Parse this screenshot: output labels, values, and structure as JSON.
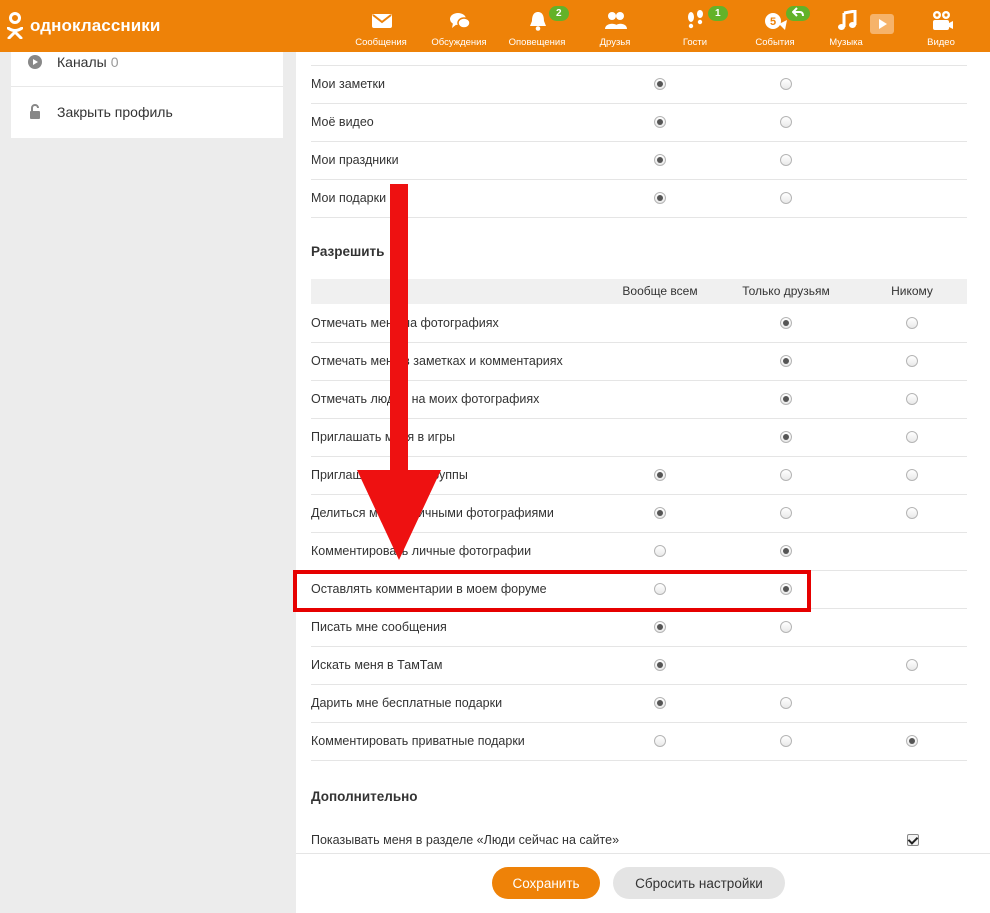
{
  "header": {
    "logo_text": "одноклассники",
    "brand_color": "#ee8208",
    "nav": [
      {
        "label": "Сообщения",
        "icon": "envelope-icon"
      },
      {
        "label": "Обсуждения",
        "icon": "chat-bubbles-icon"
      },
      {
        "label": "Оповещения",
        "icon": "bell-icon",
        "badge": "2"
      },
      {
        "label": "Друзья",
        "icon": "friends-icon"
      },
      {
        "label": "Гости",
        "icon": "footprints-icon",
        "badge": "1"
      },
      {
        "label": "События",
        "icon": "events-icon",
        "badge_icon": "reply-arrow-icon"
      },
      {
        "label": "Музыка",
        "icon": "music-note-icon"
      },
      {
        "label": "",
        "icon": "video-play-icon"
      },
      {
        "label": "Видео",
        "icon": "video-camera-icon"
      }
    ]
  },
  "sidebar": {
    "items": [
      {
        "label": "Каналы",
        "count": "0",
        "icon": "channels-icon"
      },
      {
        "label": "Закрыть профиль",
        "icon": "lock-icon"
      }
    ]
  },
  "visibility_rows": [
    {
      "label": "Мои заметки",
      "col1": true,
      "col2": false
    },
    {
      "label": "Моё видео",
      "col1": true,
      "col2": false
    },
    {
      "label": "Мои праздники",
      "col1": true,
      "col2": false
    },
    {
      "label": "Мои подарки",
      "col1": true,
      "col2": false
    }
  ],
  "allow_section": {
    "title": "Разрешить",
    "columns": [
      "Вообще всем",
      "Только друзьям",
      "Никому"
    ],
    "rows": [
      {
        "label": "Отмечать меня на фотографиях",
        "options": [
          null,
          true,
          false
        ]
      },
      {
        "label": "Отмечать меня в заметках и комментариях",
        "options": [
          null,
          true,
          false
        ]
      },
      {
        "label": "Отмечать людей на моих фотографиях",
        "options": [
          null,
          true,
          false
        ]
      },
      {
        "label": "Приглашать меня в игры",
        "options": [
          null,
          true,
          false
        ]
      },
      {
        "label": "Приглашать меня в группы",
        "options": [
          true,
          false,
          false
        ]
      },
      {
        "label": "Делиться моими личными фотографиями",
        "options": [
          true,
          false,
          false
        ]
      },
      {
        "label": "Комментировать личные фотографии",
        "options": [
          false,
          true,
          null
        ]
      },
      {
        "label": "Оставлять комментарии в моем форуме",
        "options": [
          false,
          true,
          null
        ],
        "highlighted": true
      },
      {
        "label": "Писать мне сообщения",
        "options": [
          true,
          false,
          null
        ]
      },
      {
        "label": "Искать меня в ТамТам",
        "options": [
          true,
          null,
          false
        ]
      },
      {
        "label": "Дарить мне бесплатные подарки",
        "options": [
          true,
          false,
          null
        ]
      },
      {
        "label": "Комментировать приватные подарки",
        "options": [
          false,
          false,
          true
        ]
      }
    ]
  },
  "extra_section": {
    "title": "Дополнительно",
    "rows": [
      {
        "label": "Показывать меня в разделе «Люди сейчас на сайте»",
        "checked": true
      }
    ]
  },
  "buttons": {
    "save": "Сохранить",
    "reset": "Сбросить настройки"
  },
  "annotation_color": "#e60000"
}
